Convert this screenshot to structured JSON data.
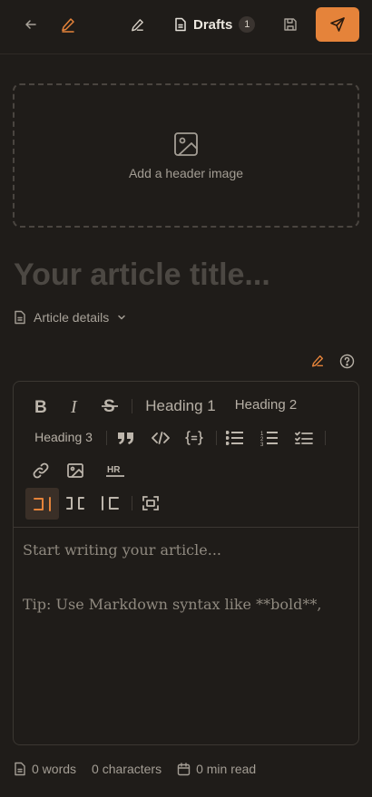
{
  "topbar": {
    "back_icon": "arrow-left-icon",
    "pen_active_icon": "pen-icon",
    "edit_icon": "pen-icon",
    "drafts_label": "Drafts",
    "drafts_count": "1",
    "save_icon": "floppy-icon",
    "publish_icon": "send-icon",
    "accent": "#e5833a"
  },
  "header_image": {
    "label": "Add a header image"
  },
  "article": {
    "title_placeholder": "Your article title...",
    "details_label": "Article details"
  },
  "toolbar": {
    "heading1": "Heading 1",
    "heading2": "Heading 2",
    "heading3": "Heading 3",
    "hr_label": "HR"
  },
  "editor": {
    "placeholder_line1": "Start writing your article...",
    "placeholder_line2": "Tip: Use Markdown syntax like **bold**,"
  },
  "stats": {
    "words": "0 words",
    "characters": "0 characters",
    "read_time": "0 min read"
  }
}
